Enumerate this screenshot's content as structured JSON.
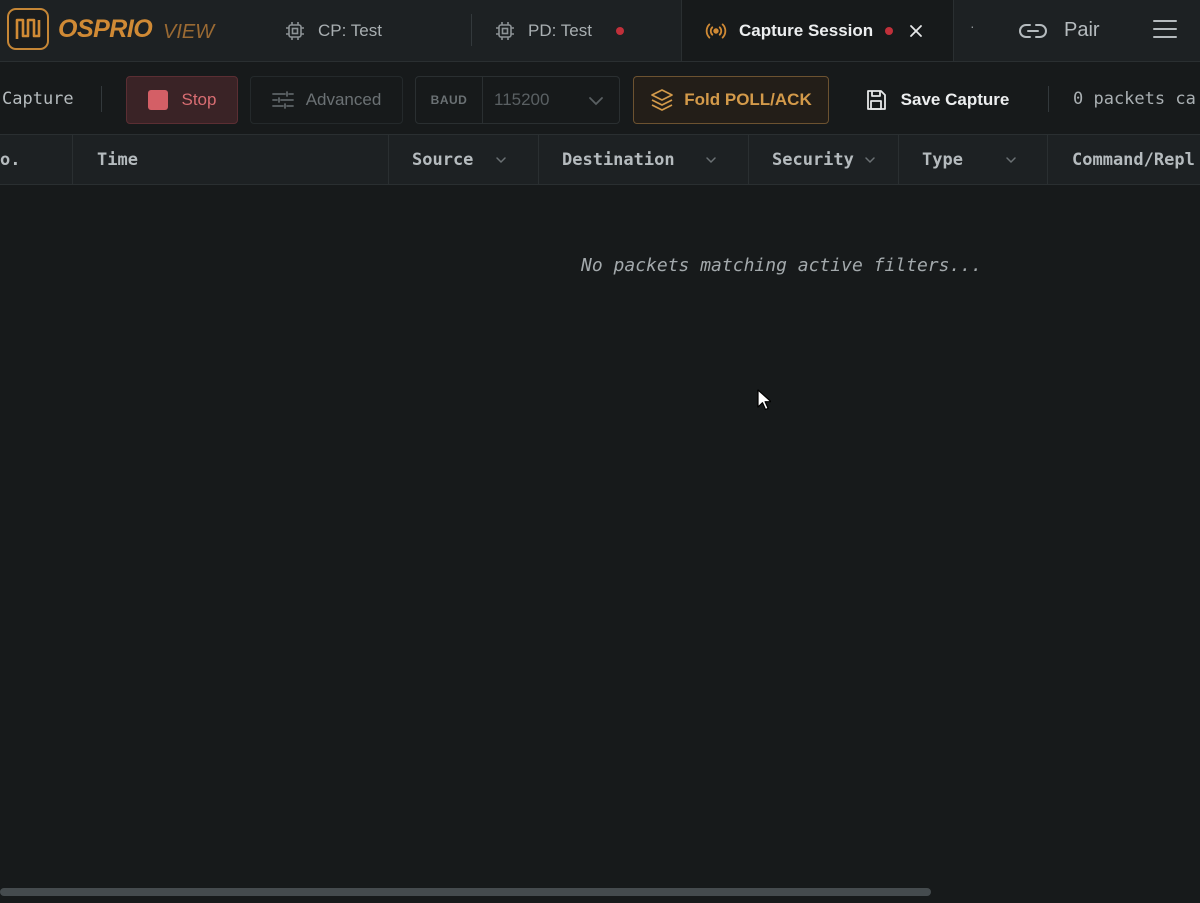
{
  "app": {
    "brand": "OSPRIO",
    "brand_suffix": "VIEW",
    "accent": "#d08a35"
  },
  "tabs": [
    {
      "label": "CP: Test",
      "icon": "chip-icon",
      "active": false,
      "unsaved": false
    },
    {
      "label": "PD: Test",
      "icon": "chip-icon",
      "active": false,
      "unsaved": true
    },
    {
      "label": "Capture Session",
      "icon": "broadcast-icon",
      "active": true,
      "unsaved": true,
      "closable": true
    }
  ],
  "topbar": {
    "pair_label": "Pair",
    "overflow_dot": "·"
  },
  "toolbar": {
    "capture_label": "Capture",
    "stop_label": "Stop",
    "advanced_label": "Advanced",
    "baud_label": "BAUD",
    "baud_value": "115200",
    "fold_label": "Fold POLL/ACK",
    "save_label": "Save Capture",
    "packet_count": "0 packets ca"
  },
  "table": {
    "columns": [
      {
        "label": "o.",
        "sortable": false
      },
      {
        "label": "Time",
        "sortable": false
      },
      {
        "label": "Source",
        "sortable": true
      },
      {
        "label": "Destination",
        "sortable": true
      },
      {
        "label": "Security",
        "sortable": true
      },
      {
        "label": "Type",
        "sortable": true
      },
      {
        "label": "Command/Repl",
        "sortable": false
      }
    ],
    "empty_message": "No packets matching active filters...",
    "rows": []
  },
  "colors": {
    "background": "#171a1b",
    "stop": "#d45f66",
    "unsaved_dot": "#c0303a"
  }
}
